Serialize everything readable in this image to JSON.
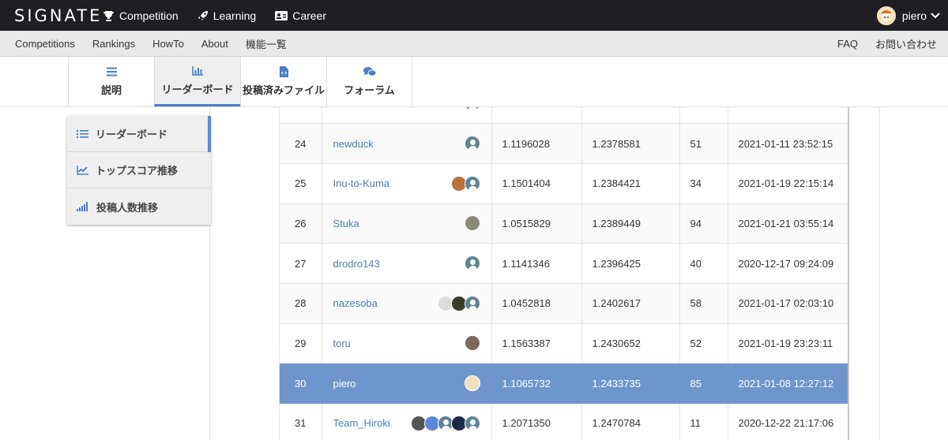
{
  "topbar": {
    "logo": "SIGNATE",
    "nav": [
      {
        "label": "Competition",
        "icon": "trophy-icon"
      },
      {
        "label": "Learning",
        "icon": "rocket-icon"
      },
      {
        "label": "Career",
        "icon": "id-card-icon"
      }
    ],
    "user": "piero"
  },
  "subbar": {
    "left": [
      "Competitions",
      "Rankings",
      "HowTo",
      "About",
      "機能一覧"
    ],
    "right": [
      "FAQ",
      "お問い合わせ"
    ]
  },
  "tabs": [
    {
      "label": "説明",
      "icon": "list-icon"
    },
    {
      "label": "リーダーボード",
      "icon": "bar-chart-icon",
      "active": true
    },
    {
      "label": "投稿済みファイル",
      "icon": "code-file-icon"
    },
    {
      "label": "フォーラム",
      "icon": "comments-icon"
    }
  ],
  "side_menu": [
    {
      "label": "リーダーボード",
      "icon": "list-ol-icon",
      "active": true
    },
    {
      "label": "トップスコア推移",
      "icon": "line-chart-icon"
    },
    {
      "label": "投稿人数推移",
      "icon": "signal-bars-icon"
    }
  ],
  "leaderboard": {
    "rows": [
      {
        "rank": "24",
        "name": "newduck",
        "score1": "1.1196028",
        "score2": "1.2378581",
        "count": "51",
        "date": "2021-01-11 23:52:15",
        "avatars": [
          "default"
        ]
      },
      {
        "rank": "25",
        "name": "Inu-to-Kuma",
        "score1": "1.1501404",
        "score2": "1.2384421",
        "count": "34",
        "date": "2021-01-19 22:15:14",
        "avatars": [
          "#b8743a",
          "default"
        ]
      },
      {
        "rank": "26",
        "name": "Stuka",
        "score1": "1.0515829",
        "score2": "1.2389449",
        "count": "94",
        "date": "2021-01-21 03:55:14",
        "avatars": [
          "#8a8a7a"
        ]
      },
      {
        "rank": "27",
        "name": "drodro143",
        "score1": "1.1141346",
        "score2": "1.2396425",
        "count": "40",
        "date": "2020-12-17 09:24:09",
        "avatars": [
          "default"
        ]
      },
      {
        "rank": "28",
        "name": "nazesoba",
        "score1": "1.0452818",
        "score2": "1.2402617",
        "count": "58",
        "date": "2021-01-17 02:03:10",
        "avatars": [
          "#dddddd",
          "#3b3b2a",
          "default"
        ]
      },
      {
        "rank": "29",
        "name": "toru",
        "score1": "1.1563387",
        "score2": "1.2430652",
        "count": "52",
        "date": "2021-01-19 23:23:11",
        "avatars": [
          "#7a6a5a"
        ]
      },
      {
        "rank": "30",
        "name": "piero",
        "score1": "1.1065732",
        "score2": "1.2433735",
        "count": "85",
        "date": "2021-01-08 12:27:12",
        "avatars": [
          "#f0e0c0"
        ],
        "me": true
      },
      {
        "rank": "31",
        "name": "Team_Hiroki",
        "score1": "1.2071350",
        "score2": "1.2470784",
        "count": "11",
        "date": "2020-12-22 21:17:06",
        "avatars": [
          "#555555",
          "#5b86d9",
          "default",
          "#1a2a4a",
          "default"
        ]
      }
    ]
  },
  "colors": {
    "topbar": "#1e1e23",
    "accent": "#4a7cc7",
    "highlight_row": "#6f96cc",
    "link": "#4d7ab8"
  }
}
